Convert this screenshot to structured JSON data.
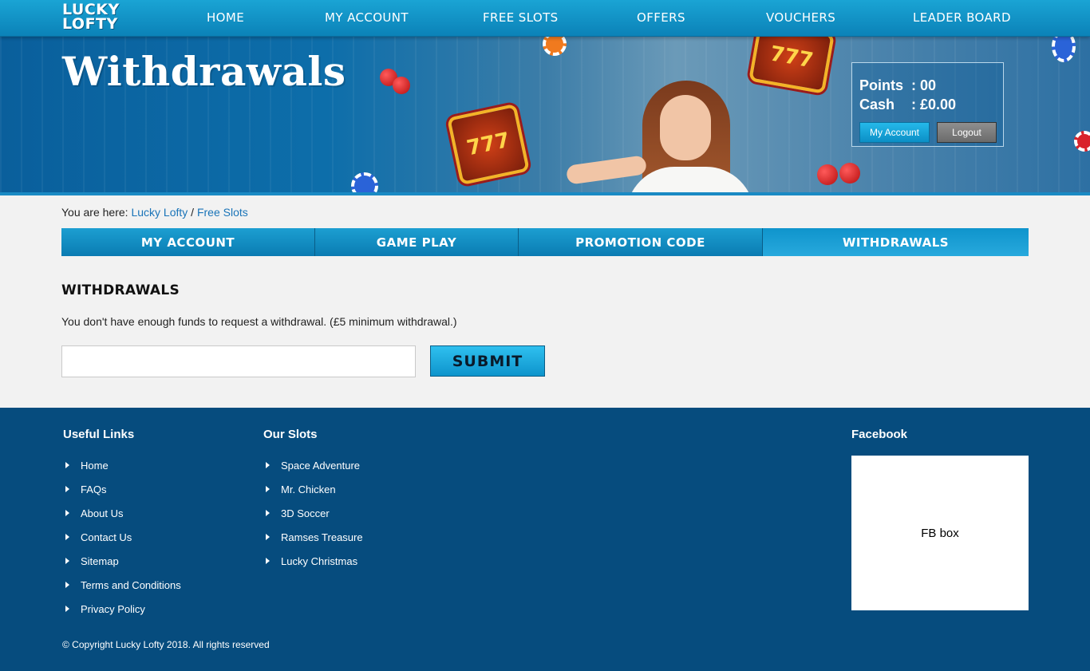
{
  "brand": {
    "logo_line1": "LUCKY",
    "logo_line2": "LOFTY"
  },
  "nav": [
    {
      "label": "HOME"
    },
    {
      "label": "MY ACCOUNT"
    },
    {
      "label": "FREE SLOTS"
    },
    {
      "label": "OFFERS"
    },
    {
      "label": "VOUCHERS"
    },
    {
      "label": "LEADER BOARD"
    }
  ],
  "hero": {
    "title": "Withdrawals",
    "reel_text": "777"
  },
  "account": {
    "points_label": "Points",
    "points_value": ": 00",
    "cash_label": "Cash",
    "cash_value": ": £0.00",
    "my_account_button": "My Account",
    "logout_button": "Logout"
  },
  "breadcrumb": {
    "prefix": "You are here:",
    "home": "Lucky Lofty",
    "separator": "/",
    "current": "Free Slots"
  },
  "tabs": [
    {
      "label": "MY ACCOUNT"
    },
    {
      "label": "GAME PLAY"
    },
    {
      "label": "PROMOTION CODE"
    },
    {
      "label": "WITHDRAWALS"
    }
  ],
  "withdrawals": {
    "heading": "WITHDRAWALS",
    "message": "You don't have enough funds to request a withdrawal. (£5 minimum withdrawal.)",
    "input_value": "",
    "submit_label": "SUBMIT"
  },
  "footer": {
    "useful_links_heading": "Useful Links",
    "useful_links": [
      "Home",
      "FAQs",
      "About Us",
      "Contact Us",
      "Sitemap",
      "Terms and Conditions",
      "Privacy Policy"
    ],
    "our_slots_heading": "Our Slots",
    "our_slots": [
      "Space Adventure",
      "Mr. Chicken",
      "3D Soccer",
      "Ramses Treasure",
      "Lucky Christmas"
    ],
    "facebook_heading": "Facebook",
    "fb_box_text": "FB box",
    "copyright": "© Copyright Lucky Lofty 2018. All rights reserved"
  },
  "colors": {
    "nav_bg": "#1aa4d4",
    "footer_bg": "#064c7e",
    "link": "#1a74b8",
    "accent": "#0f94cc"
  }
}
